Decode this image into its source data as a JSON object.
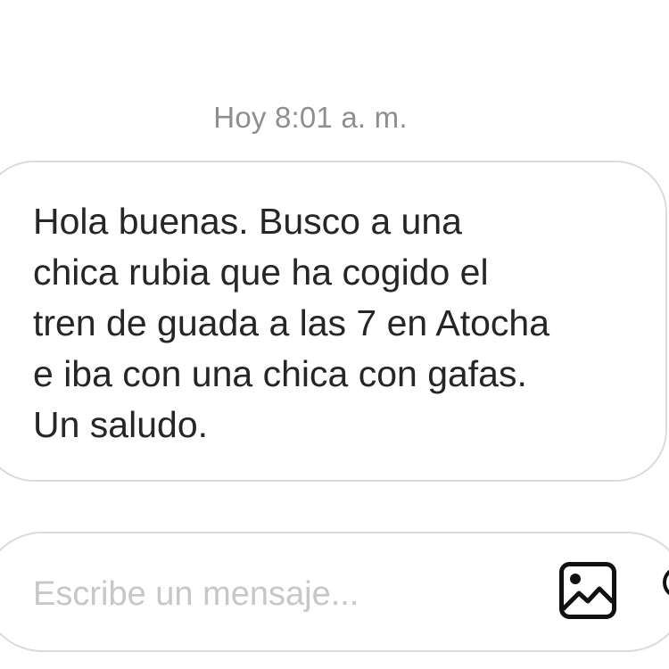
{
  "conversation": {
    "timestamp": "Hoy 8:01 a. m.",
    "messages": [
      {
        "text": "Hola buenas. Busco a una\nchica rubia que ha cogido el\ntren de guada a las 7 en Atocha\ne iba con una chica con gafas.\nUn saludo."
      }
    ]
  },
  "composer": {
    "placeholder": "Escribe un mensaje...",
    "value": "",
    "gallery_icon": "image-gallery-icon",
    "extra_icon": "circle-icon"
  },
  "colors": {
    "background": "#ffffff",
    "text": "#262626",
    "timestamp": "#8e8e8e",
    "placeholder": "#c7c7c7",
    "border": "#dbdbdb"
  }
}
